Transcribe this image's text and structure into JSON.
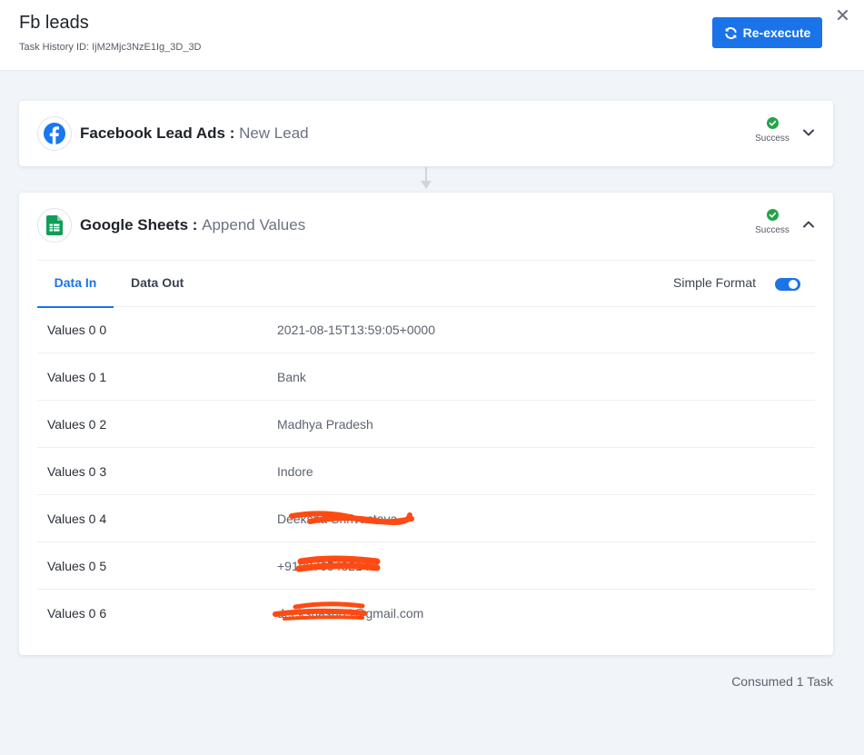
{
  "header": {
    "title": "Fb leads",
    "task_history": "Task History ID: IjM2Mjc3NzE1Ig_3D_3D",
    "reexecute_label": "Re-execute"
  },
  "steps": [
    {
      "app": "Facebook Lead Ads",
      "separator": " : ",
      "event": "New Lead",
      "status": "Success",
      "icon": "facebook-icon",
      "expanded": false
    },
    {
      "app": "Google Sheets",
      "separator": " : ",
      "event": "Append Values",
      "status": "Success",
      "icon": "google-sheets-icon",
      "expanded": true
    }
  ],
  "tabs": [
    {
      "label": "Data In",
      "active": true
    },
    {
      "label": "Data Out",
      "active": false
    }
  ],
  "simple_format": {
    "label": "Simple Format",
    "enabled": true
  },
  "rows": [
    {
      "key": "Values 0 0",
      "value": "2021-08-15T13:59:05+0000"
    },
    {
      "key": "Values 0 1",
      "value": "Bank"
    },
    {
      "key": "Values 0 2",
      "value": "Madhya Pradesh"
    },
    {
      "key": "Values 0 3",
      "value": "Indore"
    },
    {
      "key": "Values 0 4",
      "value": "Deeksha Shrivastava"
    },
    {
      "key": "Values 0 5",
      "value": "+919876543214"
    },
    {
      "key": "Values 0 6",
      "value": "deekshash05@gmail.com"
    }
  ],
  "footer": {
    "consumed": "Consumed 1 Task"
  },
  "colors": {
    "accent": "#1a73e8",
    "success": "#22a447",
    "redaction": "#ff4a12",
    "background": "#f1f4f9"
  }
}
